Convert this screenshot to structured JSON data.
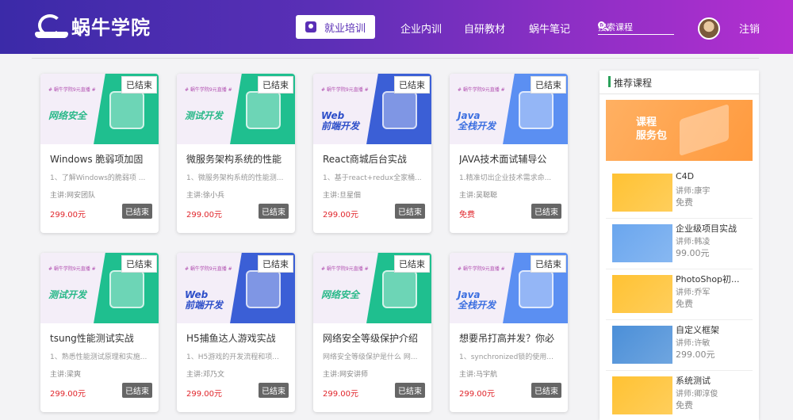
{
  "header": {
    "logo_text": "蜗牛学院",
    "nav": [
      "就业培训",
      "企业内训",
      "自研教材",
      "蜗牛笔记"
    ],
    "search_placeholder": "搜索课程",
    "logout": "注销"
  },
  "end_badge": "已结束",
  "courses": [
    {
      "thumb_tag": "# 蜗牛学院9元直播 #",
      "thumb_title": "网络安全",
      "thumb_color": "#1fbf8f",
      "thumb_text_color": "#2bb98a",
      "title": "Windows 脆弱项加固",
      "desc": "1、了解Windows的脆弱项 ...",
      "teacher": "主讲:网安团队",
      "price": "299.00元"
    },
    {
      "thumb_tag": "# 蜗牛学院9元直播 #",
      "thumb_title": "测试开发",
      "thumb_color": "#1fbf8f",
      "thumb_text_color": "#2bb98a",
      "title": "微服务架构系统的性能",
      "desc": "1、微服务架构系统的性能测...",
      "teacher": "主讲:徐小兵",
      "price": "299.00元"
    },
    {
      "thumb_tag": "# 蜗牛学院9元直播 #",
      "thumb_title": "Web\n前端开发",
      "thumb_color": "#3b5fd6",
      "thumb_text_color": "#2e4fc9",
      "title": "React商城后台实战",
      "desc": "1、基于react+redux全家桶...",
      "teacher": "主讲:旦星佃",
      "price": "299.00元"
    },
    {
      "thumb_tag": "# 蜗牛学院9元直播 #",
      "thumb_title": "Java\n全栈开发",
      "thumb_color": "#5b8ff2",
      "thumb_text_color": "#3c6fe0",
      "title": "JAVA技术面试辅导公",
      "desc": "1.精准切出企业技术需求命...",
      "teacher": "主讲:吴聪聪",
      "price": "免费"
    },
    {
      "thumb_tag": "# 蜗牛学院9元直播 #",
      "thumb_title": "测试开发",
      "thumb_color": "#1fbf8f",
      "thumb_text_color": "#2bb98a",
      "title": "tsung性能测试实战",
      "desc": "1、熟悉性能测试原理和实施...",
      "teacher": "主讲:梁爽",
      "price": "299.00元"
    },
    {
      "thumb_tag": "# 蜗牛学院9元直播 #",
      "thumb_title": "Web\n前端开发",
      "thumb_color": "#3b5fd6",
      "thumb_text_color": "#2e4fc9",
      "title": "H5捕鱼达人游戏实战",
      "desc": "1、H5游戏的开发流程和项...",
      "teacher": "主讲:邓乃文",
      "price": "299.00元"
    },
    {
      "thumb_tag": "# 蜗牛学院9元直播 #",
      "thumb_title": "网络安全",
      "thumb_color": "#1fbf8f",
      "thumb_text_color": "#2bb98a",
      "title": "网络安全等级保护介绍",
      "desc": "网络安全等级保护是什么 网...",
      "teacher": "主讲:网安讲师",
      "price": "299.00元"
    },
    {
      "thumb_tag": "# 蜗牛学院9元直播 #",
      "thumb_title": "Java\n全栈开发",
      "thumb_color": "#5b8ff2",
      "thumb_text_color": "#3c6fe0",
      "title": "想要吊打高并发？你必",
      "desc": "1、synchronized锁的使用...",
      "teacher": "主讲:马宇航",
      "price": "299.00元"
    }
  ],
  "sidebar": {
    "title": "推荐课程",
    "banner_text": "课程\n服务包",
    "items": [
      {
        "title": "C4D",
        "teacher": "讲师:康宇",
        "price": "免费",
        "color": "#ffc233"
      },
      {
        "title": "企业级项目实战",
        "teacher": "讲师:韩凌",
        "price": "99.00元",
        "color": "#6aa6ee"
      },
      {
        "title": "PhotoShop初...",
        "teacher": "讲师:乔军",
        "price": "免费",
        "color": "#ffc233"
      },
      {
        "title": "自定义框架",
        "teacher": "讲师:许敏",
        "price": "299.00元",
        "color": "#4b8fd8"
      },
      {
        "title": "系统测试",
        "teacher": "讲师:卿淳俊",
        "price": "免费",
        "color": "#ffc233"
      }
    ]
  }
}
